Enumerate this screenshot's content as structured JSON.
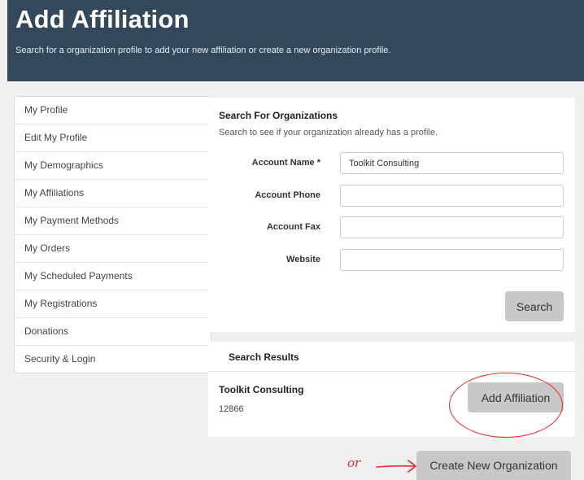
{
  "header": {
    "title": "Add Affiliation",
    "subtitle": "Search for a organization profile to add your new affiliation or create a new organization profile."
  },
  "sidebar": {
    "items": [
      {
        "label": "My Profile"
      },
      {
        "label": "Edit My Profile"
      },
      {
        "label": "My Demographics"
      },
      {
        "label": "My Affiliations"
      },
      {
        "label": "My Payment Methods"
      },
      {
        "label": "My Orders"
      },
      {
        "label": "My Scheduled Payments"
      },
      {
        "label": "My Registrations"
      },
      {
        "label": "Donations"
      },
      {
        "label": "Security & Login"
      }
    ]
  },
  "search": {
    "title": "Search For Organizations",
    "subtitle": "Search to see if your organization already has a profile.",
    "fields": {
      "account_name": {
        "label": "Account Name *",
        "value": "Toolkit Consulting"
      },
      "account_phone": {
        "label": "Account Phone",
        "value": ""
      },
      "account_fax": {
        "label": "Account Fax",
        "value": ""
      },
      "website": {
        "label": "Website",
        "value": ""
      }
    },
    "button_label": "Search"
  },
  "results": {
    "title": "Search Results",
    "items": [
      {
        "name": "Toolkit Consulting",
        "id": "12866",
        "button_label": "Add Affiliation"
      }
    ]
  },
  "create_button_label": "Create New Organization",
  "annotation": {
    "or_text": "or",
    "color": "#e8262b"
  }
}
